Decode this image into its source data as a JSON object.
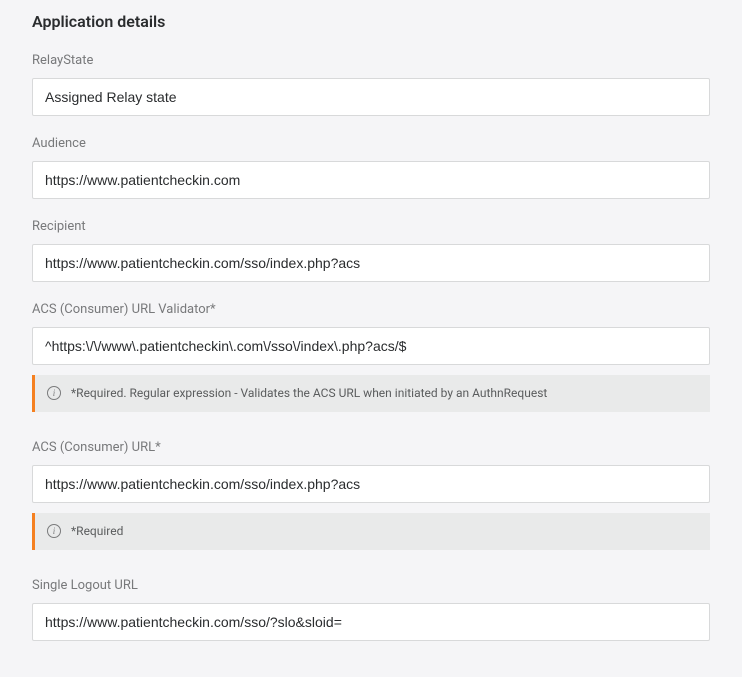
{
  "section_title": "Application details",
  "fields": {
    "relay_state": {
      "label": "RelayState",
      "value": "Assigned Relay state"
    },
    "audience": {
      "label": "Audience",
      "value": "https://www.patientcheckin.com"
    },
    "recipient": {
      "label": "Recipient",
      "value": "https://www.patientcheckin.com/sso/index.php?acs"
    },
    "acs_validator": {
      "label": "ACS (Consumer) URL Validator*",
      "value": "^https:\\/\\/www\\.patientcheckin\\.com\\/sso\\/index\\.php?acs/$",
      "info": "*Required. Regular expression - Validates the ACS URL when initiated by an AuthnRequest"
    },
    "acs_url": {
      "label": "ACS (Consumer) URL*",
      "value": "https://www.patientcheckin.com/sso/index.php?acs",
      "info": "*Required"
    },
    "slo_url": {
      "label": "Single Logout URL",
      "value": "https://www.patientcheckin.com/sso/?slo&sloid="
    }
  }
}
